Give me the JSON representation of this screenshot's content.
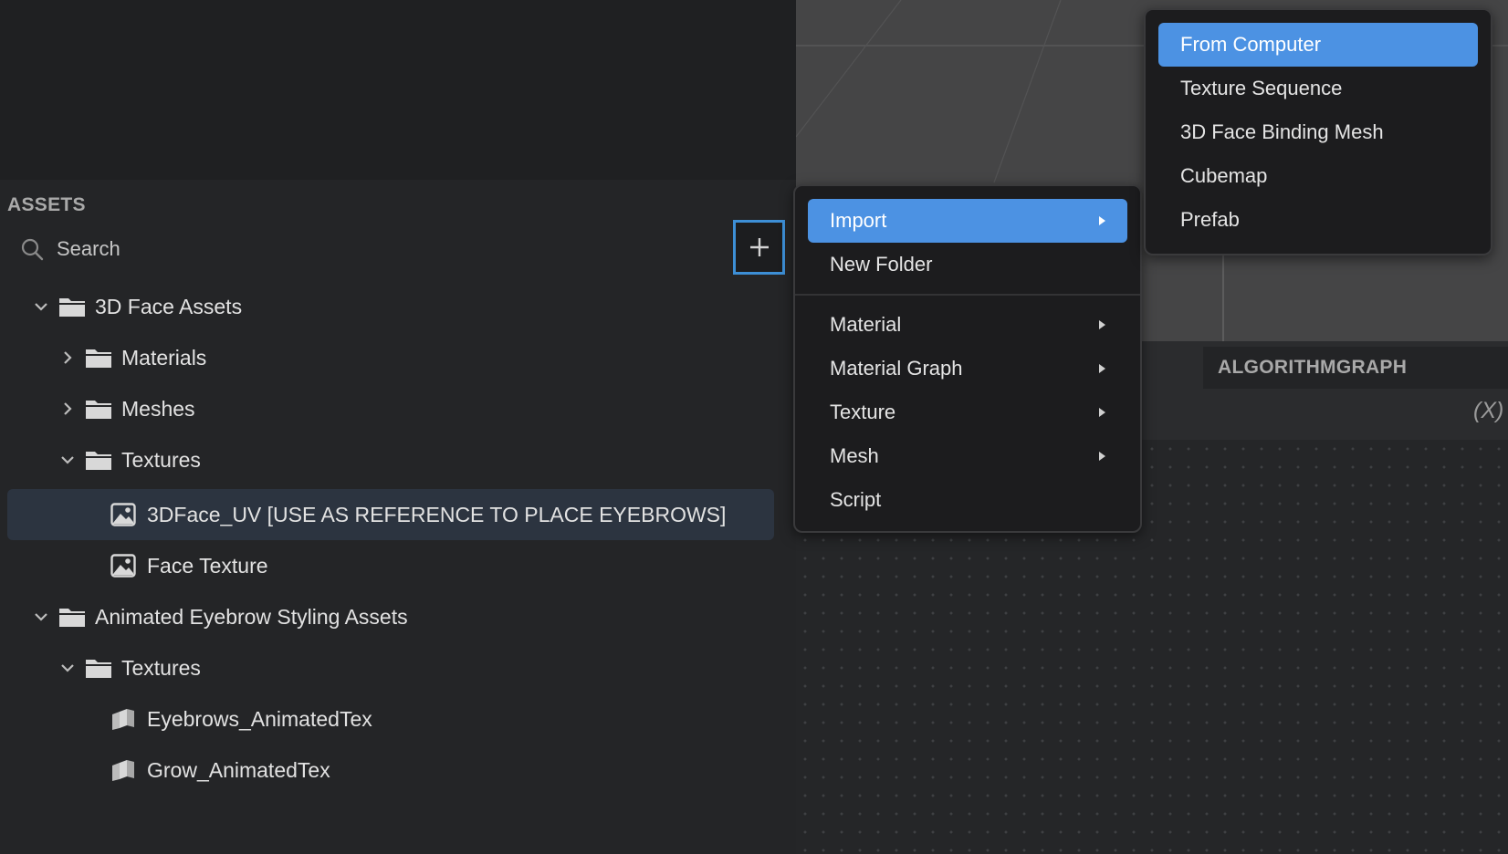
{
  "assets_panel": {
    "title": "ASSETS",
    "search": {
      "placeholder": "Search"
    },
    "tree": [
      {
        "label": "3D Face Assets",
        "type": "folder",
        "expanded": true,
        "depth": 0
      },
      {
        "label": "Materials",
        "type": "folder",
        "expanded": false,
        "depth": 1
      },
      {
        "label": "Meshes",
        "type": "folder",
        "expanded": false,
        "depth": 1
      },
      {
        "label": "Textures",
        "type": "folder",
        "expanded": true,
        "depth": 1
      },
      {
        "label": "3DFace_UV [USE AS REFERENCE TO PLACE EYEBROWS]",
        "type": "image",
        "depth": 2,
        "selected": true
      },
      {
        "label": "Face Texture",
        "type": "image",
        "depth": 2
      },
      {
        "label": "Animated Eyebrow Styling Assets",
        "type": "folder",
        "expanded": true,
        "depth": 0
      },
      {
        "label": "Textures",
        "type": "folder",
        "expanded": true,
        "depth": 1
      },
      {
        "label": "Eyebrows_AnimatedTex",
        "type": "animated-texture",
        "depth": 2
      },
      {
        "label": "Grow_AnimatedTex",
        "type": "animated-texture",
        "depth": 2
      }
    ]
  },
  "context_menu": {
    "items": [
      {
        "label": "Import",
        "submenu": true,
        "highlighted": true
      },
      {
        "label": "New Folder",
        "submenu": false
      },
      {
        "label": "Material",
        "submenu": true
      },
      {
        "label": "Material Graph",
        "submenu": true
      },
      {
        "label": "Texture",
        "submenu": true
      },
      {
        "label": "Mesh",
        "submenu": true
      },
      {
        "label": "Script",
        "submenu": false
      }
    ]
  },
  "import_submenu": {
    "items": [
      {
        "label": "From Computer",
        "highlighted": true
      },
      {
        "label": "Texture Sequence"
      },
      {
        "label": "3D Face Binding Mesh"
      },
      {
        "label": "Cubemap"
      },
      {
        "label": "Prefab"
      }
    ]
  },
  "graph_panel": {
    "tab_label": "ALGORITHMGRAPH",
    "variable_symbol": "(X)"
  },
  "colors": {
    "accent": "#4c92e3",
    "panel_bg": "#242527",
    "menu_bg": "#1c1c1e",
    "selected_row": "#2c3440",
    "add_button_border": "#3d8fd6"
  },
  "icons": {
    "search": "search-icon",
    "add": "plus-icon",
    "folder": "folder-icon",
    "image": "image-file-icon",
    "animated": "animated-texture-icon",
    "expand": "chevron-down-icon",
    "collapse": "chevron-right-icon",
    "submenu": "submenu-arrow-icon"
  }
}
